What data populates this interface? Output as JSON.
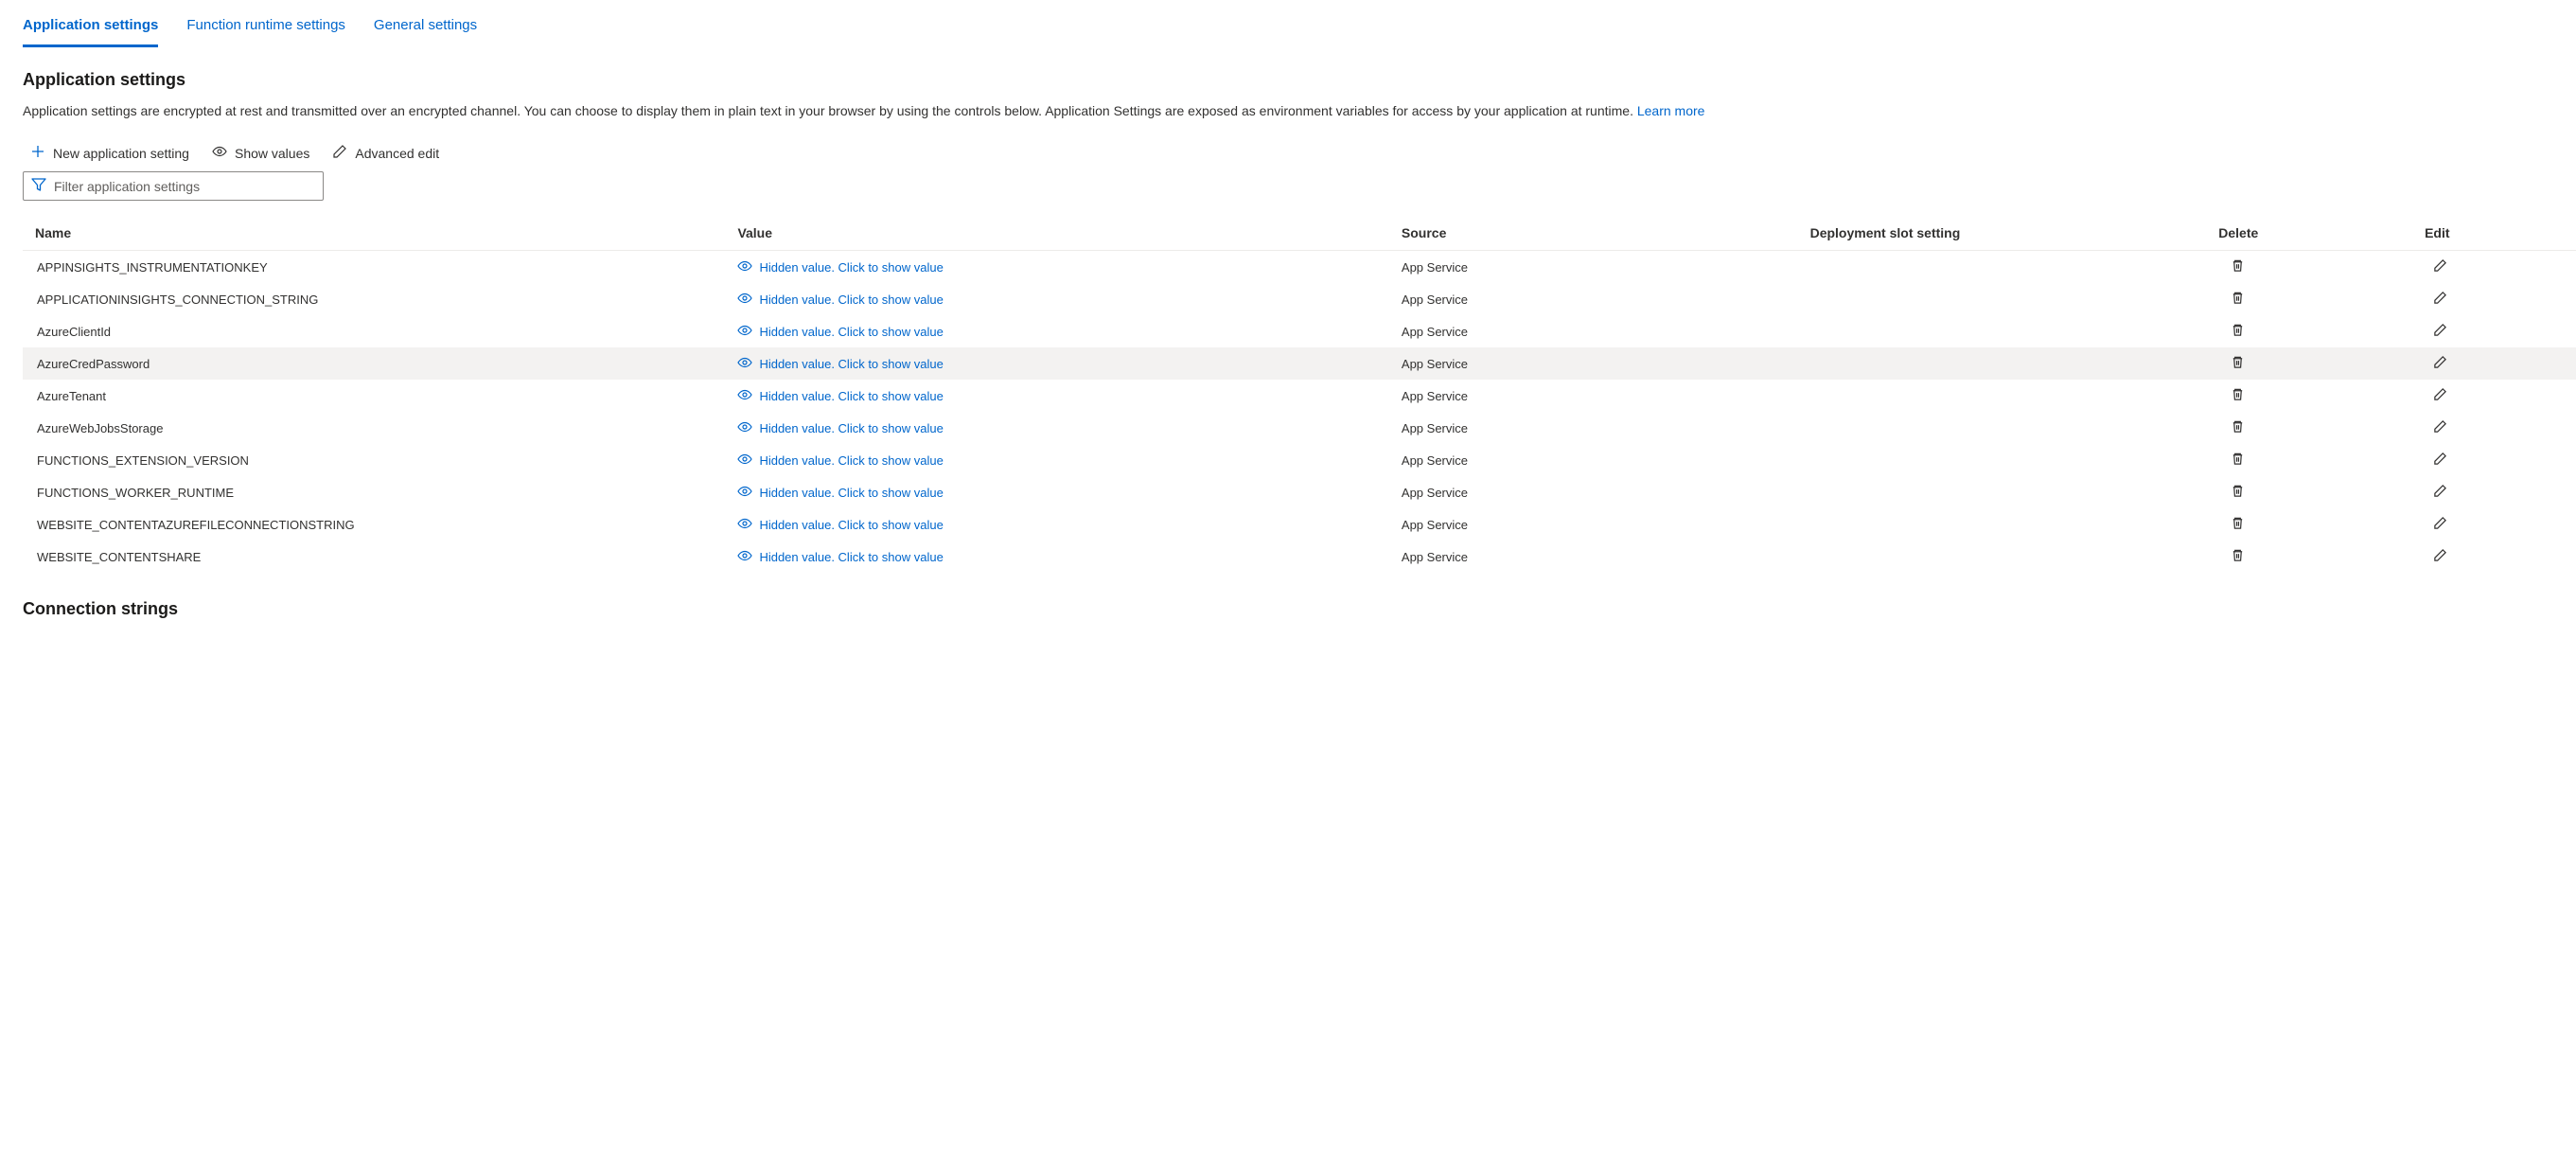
{
  "tabs": [
    {
      "label": "Application settings",
      "active": true
    },
    {
      "label": "Function runtime settings",
      "active": false
    },
    {
      "label": "General settings",
      "active": false
    }
  ],
  "section": {
    "title": "Application settings",
    "description_prefix": "Application settings are encrypted at rest and transmitted over an encrypted channel. You can choose to display them in plain text in your browser by using the controls below. Application Settings are exposed as environment variables for access by your application at runtime. ",
    "learn_more": "Learn more"
  },
  "toolbar": {
    "new_setting": "New application setting",
    "show_values": "Show values",
    "advanced_edit": "Advanced edit"
  },
  "filter": {
    "placeholder": "Filter application settings"
  },
  "columns": {
    "name": "Name",
    "value": "Value",
    "source": "Source",
    "slot": "Deployment slot setting",
    "delete": "Delete",
    "edit": "Edit"
  },
  "hidden_value_text": "Hidden value. Click to show value",
  "rows": [
    {
      "name": "APPINSIGHTS_INSTRUMENTATIONKEY",
      "source": "App Service",
      "highlight": false
    },
    {
      "name": "APPLICATIONINSIGHTS_CONNECTION_STRING",
      "source": "App Service",
      "highlight": false
    },
    {
      "name": "AzureClientId",
      "source": "App Service",
      "highlight": false
    },
    {
      "name": "AzureCredPassword",
      "source": "App Service",
      "highlight": true
    },
    {
      "name": "AzureTenant",
      "source": "App Service",
      "highlight": false
    },
    {
      "name": "AzureWebJobsStorage",
      "source": "App Service",
      "highlight": false
    },
    {
      "name": "FUNCTIONS_EXTENSION_VERSION",
      "source": "App Service",
      "highlight": false
    },
    {
      "name": "FUNCTIONS_WORKER_RUNTIME",
      "source": "App Service",
      "highlight": false
    },
    {
      "name": "WEBSITE_CONTENTAZUREFILECONNECTIONSTRING",
      "source": "App Service",
      "highlight": false
    },
    {
      "name": "WEBSITE_CONTENTSHARE",
      "source": "App Service",
      "highlight": false
    }
  ],
  "connection_strings": {
    "title": "Connection strings"
  }
}
